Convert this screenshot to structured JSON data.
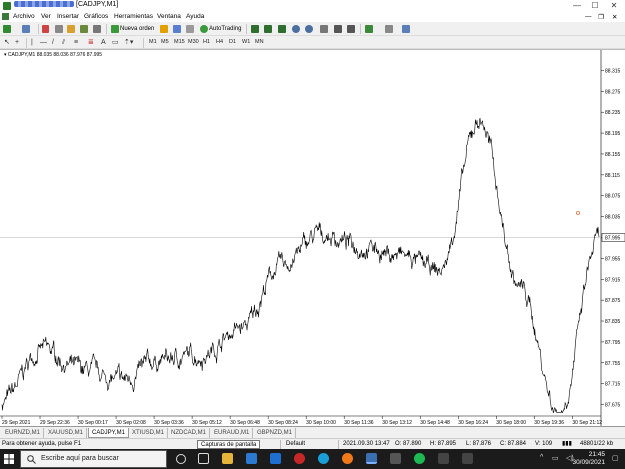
{
  "window": {
    "title_suffix": "[CADJPY,M1]",
    "min": "—",
    "max": "☐",
    "close": "✕"
  },
  "menu": [
    "Archivo",
    "Ver",
    "Insertar",
    "Gráficos",
    "Herramientas",
    "Ventana",
    "Ayuda"
  ],
  "menu_right": {
    "min": "—",
    "restore": "❐",
    "close": "✕"
  },
  "toolbar1": {
    "new_order": "Nueva orden",
    "autotrading": "AutoTrading"
  },
  "toolbar2": {
    "timeframes": [
      "M1",
      "M5",
      "M15",
      "M30",
      "H1",
      "H4",
      "D1",
      "W1",
      "MN"
    ]
  },
  "chart": {
    "header": "CADJPY,M1  88.035 88.036 87.976 87.995",
    "price_labels": [
      "88.315",
      "88.275",
      "88.235",
      "88.195",
      "88.155",
      "88.115",
      "88.075",
      "88.035",
      "87.995",
      "87.955",
      "87.915",
      "87.875",
      "87.835",
      "87.795",
      "87.755",
      "87.715",
      "87.675"
    ],
    "current_price": "87.995",
    "time_labels": [
      "29 Sep 2021",
      "29 Sep 22:36",
      "30 Sep 00:17",
      "30 Sep 02:08",
      "30 Sep 03:36",
      "30 Sep 05:12",
      "30 Sep 06:48",
      "30 Sep 08:24",
      "30 Sep 10:00",
      "30 Sep 11:36",
      "30 Sep 13:12",
      "30 Sep 14:48",
      "30 Sep 16:24",
      "30 Sep 18:00",
      "30 Sep 19:36",
      "30 Sep 21:12"
    ],
    "colors": {
      "line": "#000000",
      "bid_line": "#b0b0b0",
      "marker": "#d04000"
    }
  },
  "chart_data": {
    "type": "line",
    "symbol": "CADJPY",
    "timeframe": "M1",
    "ylim": [
      87.655,
      88.335
    ],
    "x": [
      "29 Sep 2021",
      "29 Sep 22:36",
      "30 Sep 00:17",
      "30 Sep 02:08",
      "30 Sep 03:36",
      "30 Sep 05:12",
      "30 Sep 06:48",
      "30 Sep 08:24",
      "30 Sep 10:00",
      "30 Sep 11:36",
      "30 Sep 13:12",
      "30 Sep 14:48",
      "30 Sep 16:24",
      "30 Sep 18:00",
      "30 Sep 19:36",
      "30 Sep 21:12"
    ],
    "series": [
      {
        "values": [
          87.68,
          87.78,
          87.74,
          87.72,
          87.76,
          87.77,
          87.82,
          87.94,
          88.0,
          87.98,
          87.96,
          87.93,
          88.22,
          87.9,
          87.66,
          87.99
        ]
      }
    ]
  },
  "tabs": [
    "EURNZD,M1",
    "XAUUSD,M1",
    "CADJPY,M1",
    "XTIUSD,M1",
    "NZDCAD,M1",
    "EURAUD,M1",
    "GBPNZD,M1"
  ],
  "active_tab": "CADJPY,M1",
  "tooltip": "Capturas de pantalla",
  "status": {
    "help": "Para obtener ayuda, pulse F1",
    "profile": "Default",
    "datetime": "2021.09.30 13:47",
    "open": "O: 87.890",
    "high": "H: 87.895",
    "low": "L: 87.876",
    "close": "C: 87.884",
    "volume": "V: 109",
    "traffic": "48801/22 kb"
  },
  "taskbar": {
    "search_placeholder": "Escribe aquí para buscar",
    "time": "21:45",
    "date": "30/09/2021"
  }
}
